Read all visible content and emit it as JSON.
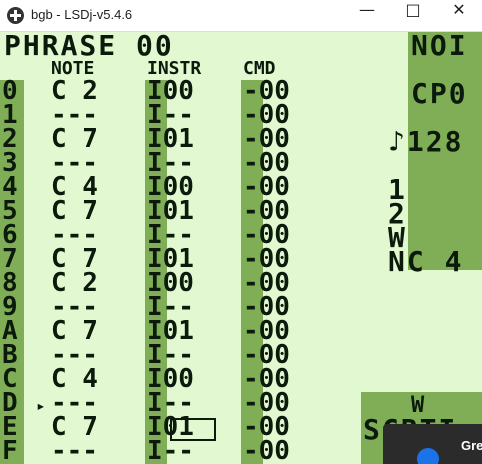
{
  "window": {
    "title": "bgb - LSDj-v5.4.6",
    "minimize": "—",
    "maximize": "□",
    "close": "✕"
  },
  "phrase": {
    "title": "PHRASE 00",
    "col_note": "NOTE",
    "col_instr": "INSTR",
    "col_cmd": "CMD",
    "rows": [
      {
        "idx": "0",
        "note": "C 2",
        "instr": "I00",
        "cmd": "-00"
      },
      {
        "idx": "1",
        "note": "---",
        "instr": "I--",
        "cmd": "-00"
      },
      {
        "idx": "2",
        "note": "C 7",
        "instr": "I01",
        "cmd": "-00"
      },
      {
        "idx": "3",
        "note": "---",
        "instr": "I--",
        "cmd": "-00"
      },
      {
        "idx": "4",
        "note": "C 4",
        "instr": "I00",
        "cmd": "-00"
      },
      {
        "idx": "5",
        "note": "C 7",
        "instr": "I01",
        "cmd": "-00"
      },
      {
        "idx": "6",
        "note": "---",
        "instr": "I--",
        "cmd": "-00"
      },
      {
        "idx": "7",
        "note": "C 7",
        "instr": "I01",
        "cmd": "-00"
      },
      {
        "idx": "8",
        "note": "C 2",
        "instr": "I00",
        "cmd": "-00"
      },
      {
        "idx": "9",
        "note": "---",
        "instr": "I--",
        "cmd": "-00"
      },
      {
        "idx": "A",
        "note": "C 7",
        "instr": "I01",
        "cmd": "-00"
      },
      {
        "idx": "B",
        "note": "---",
        "instr": "I--",
        "cmd": "-00"
      },
      {
        "idx": "C",
        "note": "C 4",
        "instr": "I00",
        "cmd": "-00"
      },
      {
        "idx": "D",
        "note": "---",
        "instr": "I--",
        "cmd": "-00"
      },
      {
        "idx": "E",
        "note": "C 7",
        "instr": "I01",
        "cmd": "-00"
      },
      {
        "idx": "F",
        "note": "---",
        "instr": "I--",
        "cmd": "-00"
      }
    ],
    "play_marker": "▸"
  },
  "side": {
    "channel": "NOI",
    "cp": "CP0",
    "tempo": "♪128",
    "ch1": "1",
    "ch2": "2",
    "ch3": "W",
    "ch4": "NC 4",
    "bottom": "SCRTI",
    "w": "W"
  },
  "popup": {
    "text": "Gre"
  },
  "colors": {
    "light": "#e1f8d0",
    "mid": "#7fae57",
    "dark": "#0b1a0b"
  }
}
